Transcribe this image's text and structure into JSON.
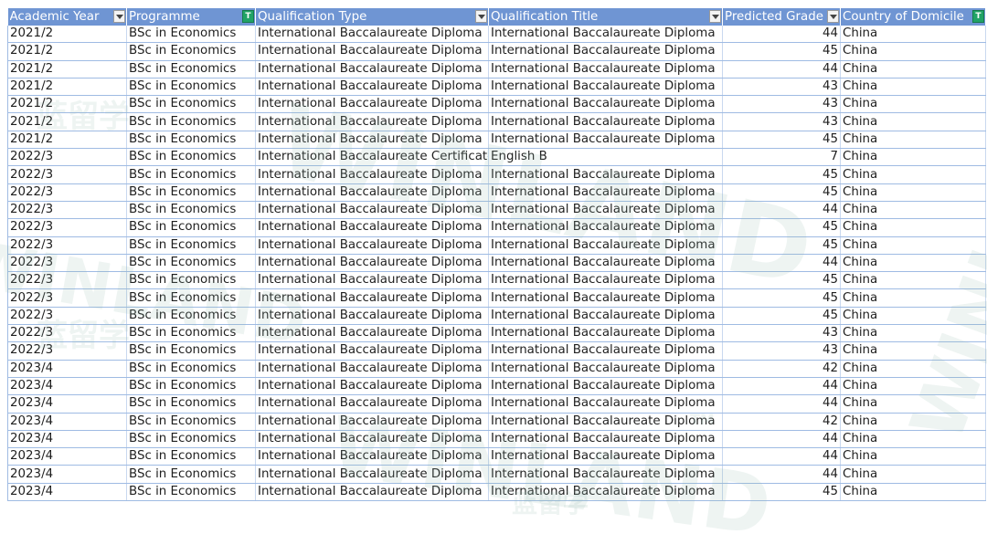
{
  "header": {
    "academic_year": "Academic Year",
    "programme": "Programme",
    "qualification_type": "Qualification Type",
    "qualification_title": "Qualification Title",
    "predicted_grade": "Predicted Grade",
    "country_of_domicile": "Country of Domicile"
  },
  "filter_glyph": "T",
  "watermark": {
    "brand": "WINLAND",
    "cn": "蓝留学",
    "tm": "TM"
  },
  "rows": [
    {
      "year": "2021/2",
      "prog": "BSc in Economics",
      "qtype": "International Baccalaureate Diploma",
      "qtitle": "International Baccalaureate Diploma",
      "grade": "44",
      "country": "China"
    },
    {
      "year": "2021/2",
      "prog": "BSc in Economics",
      "qtype": "International Baccalaureate Diploma",
      "qtitle": "International Baccalaureate Diploma",
      "grade": "45",
      "country": "China"
    },
    {
      "year": "2021/2",
      "prog": "BSc in Economics",
      "qtype": "International Baccalaureate Diploma",
      "qtitle": "International Baccalaureate Diploma",
      "grade": "44",
      "country": "China"
    },
    {
      "year": "2021/2",
      "prog": "BSc in Economics",
      "qtype": "International Baccalaureate Diploma",
      "qtitle": "International Baccalaureate Diploma",
      "grade": "43",
      "country": "China"
    },
    {
      "year": "2021/2",
      "prog": "BSc in Economics",
      "qtype": "International Baccalaureate Diploma",
      "qtitle": "International Baccalaureate Diploma",
      "grade": "43",
      "country": "China"
    },
    {
      "year": "2021/2",
      "prog": "BSc in Economics",
      "qtype": "International Baccalaureate Diploma",
      "qtitle": "International Baccalaureate Diploma",
      "grade": "43",
      "country": "China"
    },
    {
      "year": "2021/2",
      "prog": "BSc in Economics",
      "qtype": "International Baccalaureate Diploma",
      "qtitle": "International Baccalaureate Diploma",
      "grade": "45",
      "country": "China"
    },
    {
      "year": "2022/3",
      "prog": "BSc in Economics",
      "qtype": "International Baccalaureate Certificates",
      "qtitle": "English B",
      "grade": "7",
      "country": "China"
    },
    {
      "year": "2022/3",
      "prog": "BSc in Economics",
      "qtype": "International Baccalaureate Diploma",
      "qtitle": "International Baccalaureate Diploma",
      "grade": "45",
      "country": "China"
    },
    {
      "year": "2022/3",
      "prog": "BSc in Economics",
      "qtype": "International Baccalaureate Diploma",
      "qtitle": "International Baccalaureate Diploma",
      "grade": "45",
      "country": "China"
    },
    {
      "year": "2022/3",
      "prog": "BSc in Economics",
      "qtype": "International Baccalaureate Diploma",
      "qtitle": "International Baccalaureate Diploma",
      "grade": "44",
      "country": "China"
    },
    {
      "year": "2022/3",
      "prog": "BSc in Economics",
      "qtype": "International Baccalaureate Diploma",
      "qtitle": "International Baccalaureate Diploma",
      "grade": "45",
      "country": "China"
    },
    {
      "year": "2022/3",
      "prog": "BSc in Economics",
      "qtype": "International Baccalaureate Diploma",
      "qtitle": "International Baccalaureate Diploma",
      "grade": "45",
      "country": "China"
    },
    {
      "year": "2022/3",
      "prog": "BSc in Economics",
      "qtype": "International Baccalaureate Diploma",
      "qtitle": "International Baccalaureate Diploma",
      "grade": "44",
      "country": "China"
    },
    {
      "year": "2022/3",
      "prog": "BSc in Economics",
      "qtype": "International Baccalaureate Diploma",
      "qtitle": "International Baccalaureate Diploma",
      "grade": "45",
      "country": "China"
    },
    {
      "year": "2022/3",
      "prog": "BSc in Economics",
      "qtype": "International Baccalaureate Diploma",
      "qtitle": "International Baccalaureate Diploma",
      "grade": "45",
      "country": "China"
    },
    {
      "year": "2022/3",
      "prog": "BSc in Economics",
      "qtype": "International Baccalaureate Diploma",
      "qtitle": "International Baccalaureate Diploma",
      "grade": "45",
      "country": "China"
    },
    {
      "year": "2022/3",
      "prog": "BSc in Economics",
      "qtype": "International Baccalaureate Diploma",
      "qtitle": "International Baccalaureate Diploma",
      "grade": "43",
      "country": "China"
    },
    {
      "year": "2022/3",
      "prog": "BSc in Economics",
      "qtype": "International Baccalaureate Diploma",
      "qtitle": "International Baccalaureate Diploma",
      "grade": "43",
      "country": "China"
    },
    {
      "year": "2023/4",
      "prog": "BSc in Economics",
      "qtype": "International Baccalaureate Diploma",
      "qtitle": "International Baccalaureate Diploma",
      "grade": "42",
      "country": "China"
    },
    {
      "year": "2023/4",
      "prog": "BSc in Economics",
      "qtype": "International Baccalaureate Diploma",
      "qtitle": "International Baccalaureate Diploma",
      "grade": "44",
      "country": "China"
    },
    {
      "year": "2023/4",
      "prog": "BSc in Economics",
      "qtype": "International Baccalaureate Diploma",
      "qtitle": "International Baccalaureate Diploma",
      "grade": "44",
      "country": "China"
    },
    {
      "year": "2023/4",
      "prog": "BSc in Economics",
      "qtype": "International Baccalaureate Diploma",
      "qtitle": "International Baccalaureate Diploma",
      "grade": "42",
      "country": "China"
    },
    {
      "year": "2023/4",
      "prog": "BSc in Economics",
      "qtype": "International Baccalaureate Diploma",
      "qtitle": "International Baccalaureate Diploma",
      "grade": "44",
      "country": "China"
    },
    {
      "year": "2023/4",
      "prog": "BSc in Economics",
      "qtype": "International Baccalaureate Diploma",
      "qtitle": "International Baccalaureate Diploma",
      "grade": "44",
      "country": "China"
    },
    {
      "year": "2023/4",
      "prog": "BSc in Economics",
      "qtype": "International Baccalaureate Diploma",
      "qtitle": "International Baccalaureate Diploma",
      "grade": "44",
      "country": "China"
    },
    {
      "year": "2023/4",
      "prog": "BSc in Economics",
      "qtype": "International Baccalaureate Diploma",
      "qtitle": "International Baccalaureate Diploma",
      "grade": "45",
      "country": "China"
    }
  ]
}
